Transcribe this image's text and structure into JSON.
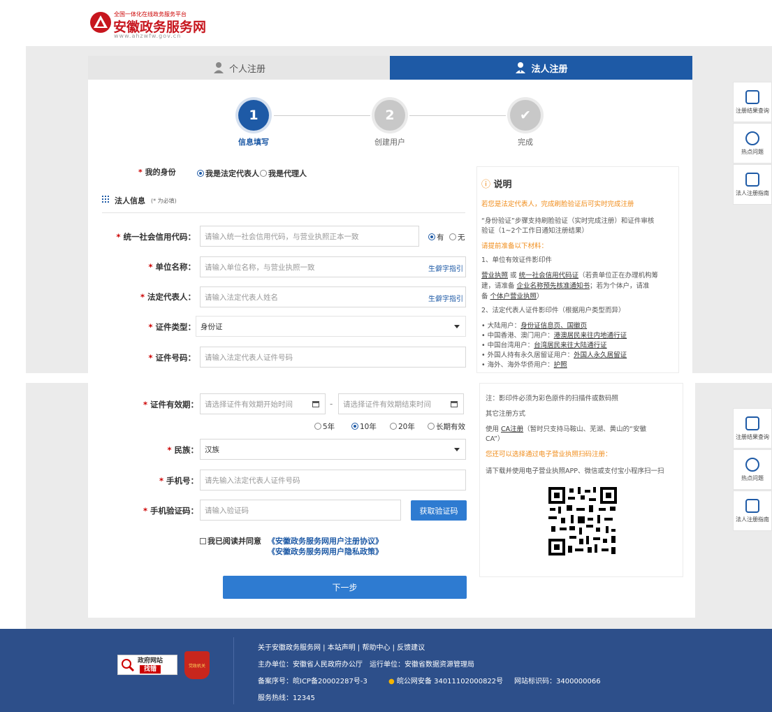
{
  "header": {
    "logo_small": "全国一体化在线政务服务平台",
    "logo_big": "安徽政务服务网",
    "logo_url": "www.ahzwfw.gov.cn"
  },
  "tabs": [
    {
      "label": "个人注册"
    },
    {
      "label": "法人注册"
    }
  ],
  "steps": [
    {
      "num": "1",
      "label": "信息填写"
    },
    {
      "num": "2",
      "label": "创建用户"
    },
    {
      "num": "✔",
      "label": "完成"
    }
  ],
  "identity": {
    "label": "我的身份",
    "options": [
      "我是法定代表人",
      "我是代理人"
    ],
    "selected": "我是法定代表人"
  },
  "section": {
    "title": "法人信息",
    "note": "(* 为必填)"
  },
  "form": {
    "credit_code": {
      "label": "统一社会信用代码：",
      "placeholder": "请输入统一社会信用代码，与营业执照正本一致",
      "opt_yes": "有",
      "opt_no": "无"
    },
    "unit_name": {
      "label": "单位名称：",
      "placeholder": "请输入单位名称，与营业执照一致",
      "link": "生僻字指引"
    },
    "legal_rep": {
      "label": "法定代表人：",
      "placeholder": "请输入法定代表人姓名",
      "link": "生僻字指引"
    },
    "cert_type": {
      "label": "证件类型：",
      "value": "身份证"
    },
    "cert_no": {
      "label": "证件号码：",
      "placeholder": "请输入法定代表人证件号码"
    },
    "validity": {
      "label": "证件有效期：",
      "start_placeholder": "请选择证件有效期开始时间",
      "end_placeholder": "请选择证件有效期结束时间",
      "dash": "-",
      "options": [
        "5年",
        "10年",
        "20年",
        "长期有效"
      ],
      "selected": "10年"
    },
    "ethnic": {
      "label": "民族：",
      "value": "汉族"
    },
    "phone": {
      "label": "手机号：",
      "placeholder": "请先输入法定代表人证件号码"
    },
    "sms": {
      "label": "手机验证码：",
      "placeholder": "请输入验证码",
      "button": "获取验证码"
    },
    "agree": {
      "text": "我已阅读并同意",
      "link1": "《安徽政务服务网用户注册协议》",
      "link2": "《安徽政务服务网用户隐私政策》"
    },
    "next": "下一步"
  },
  "info": {
    "title": "说明",
    "l1": "若您是法定代表人，完成刷脸验证后可实时完成注册",
    "l2": "“身份验证”步骤支持刷脸验证（实时完成注册）和证件审核",
    "l3": "验证（1~2个工作日通知注册结果）",
    "l4": "请提前准备以下材料：",
    "l5": "1、单位有效证件影印件",
    "l6a": "营业执照",
    "l6b": " 或 ",
    "l6c": "统一社会信用代码证",
    "l6d": "（若贵单位正在办理机构筹",
    "l7a": "建，请准备 ",
    "l7b": "企业名称预先核准通知书",
    "l7c": "；若为个体户，请准",
    "l8a": "备 ",
    "l8b": "个体户营业执照",
    "l8c": "）",
    "l9": "2、法定代表人证件影印件（根据用户类型而异）",
    "b1a": "• 大陆用户：",
    "b1b": "身份证信息页、国徽页",
    "b2a": "• 中国香港、澳门用户：",
    "b2b": "港澳居民来往内地通行证",
    "b3a": "• 中国台湾用户：",
    "b3b": "台湾居民来往大陆通行证",
    "b4a": "• 外国人持有永久居留证用户：",
    "b4b": "外国人永久居留证",
    "b5a": "• 海外、海外华侨用户：",
    "b5b": "护照",
    "n1": "注：影印件必须为彩色原件的扫描件或数码照",
    "n2": "其它注册方式",
    "n3a": "使用 ",
    "n3b": "CA注册",
    "n3c": "（暂时只支持马鞍山、芜湖、黄山的“安徽",
    "n4": "CA”）",
    "n5": "您还可以选择通过电子营业执照扫码注册：",
    "n6": "请下载并使用电子营业执照APP、微信或支付宝小程序扫一扫"
  },
  "side": [
    "注册结果查询",
    "热点问题",
    "法人注册指南"
  ],
  "side2": [
    "注册结果查询",
    "热点问题",
    "法人注册指南"
  ],
  "footer": {
    "links": "关于安徽政务服务网 | 本站声明 | 帮助中心 | 反馈建议",
    "host": "主办单位：安徽省人民政府办公厅　运行单位：安徽省数据资源管理局",
    "icp": "备案序号：皖ICP备20002287号-3",
    "police": "皖公网安备 34011102000822号",
    "site_id": "网站标识码：3400000066",
    "hotline": "服务热线：12345",
    "badge1_top": "政府网站",
    "badge1_bottom": "找错",
    "badge2": "党政机关"
  }
}
